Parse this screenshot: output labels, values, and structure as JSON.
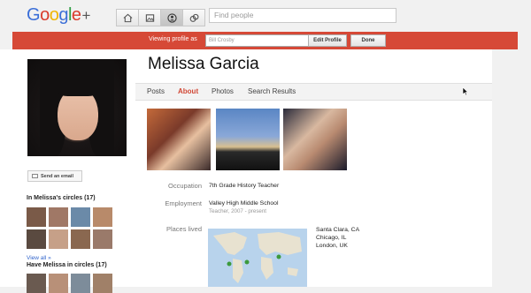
{
  "logo": {
    "g": "G",
    "o1": "o",
    "o2": "o",
    "g2": "g",
    "l": "l",
    "e": "e",
    "plus": "+"
  },
  "nav": {
    "buttons": [
      "home-icon",
      "photos-icon",
      "profile-icon",
      "circles-icon"
    ]
  },
  "search": {
    "placeholder": "Find people"
  },
  "viewbar": {
    "label": "Viewing profile as",
    "input_value": "Bill Crosby",
    "edit_label": "Edit Profile",
    "done_label": "Done"
  },
  "profile": {
    "name": "Melissa Garcia",
    "tabs": [
      {
        "label": "Posts"
      },
      {
        "label": "About"
      },
      {
        "label": "Photos"
      },
      {
        "label": "Search Results"
      }
    ],
    "send_email": "Send an email",
    "in_circles_title": "In Melissa's circles (17)",
    "view_all": "View all »",
    "have_in_circles_title": "Have Melissa in circles (17)",
    "occupation_label": "Occupation",
    "occupation_value": "7th Grade History Teacher",
    "employment_label": "Employment",
    "employment_value": "Valley High Middle School",
    "employment_sub": "Teacher, 2007 - present",
    "places_label": "Places lived",
    "places": [
      "Santa Clara, CA",
      "Chicago, IL",
      "London, UK"
    ]
  },
  "colors": {
    "accent_red": "#d64937",
    "link_blue": "#3366cc",
    "active_tab": "#d14836"
  }
}
